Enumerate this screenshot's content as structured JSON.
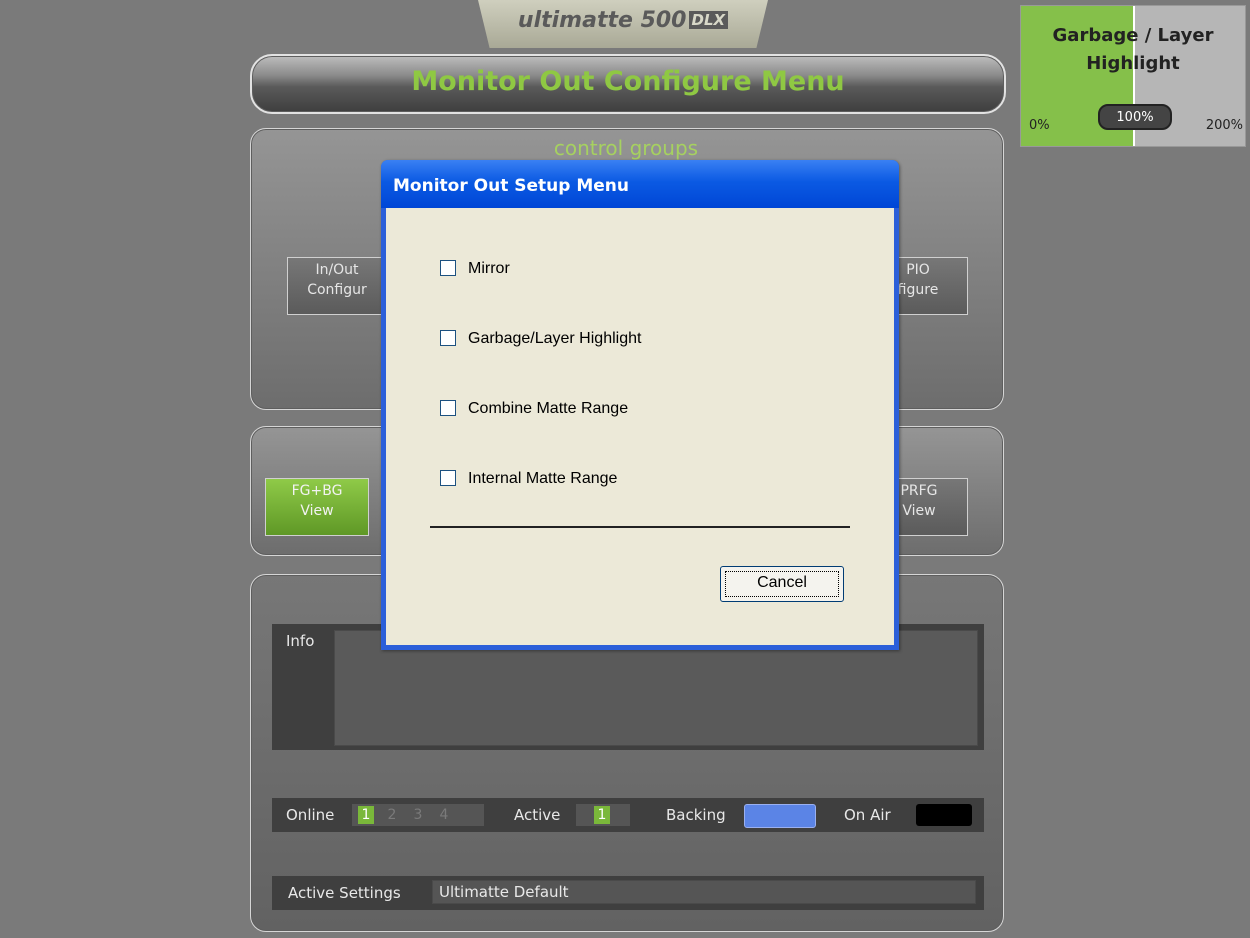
{
  "logo": {
    "text": "ultimatte 500",
    "badge": "DLX"
  },
  "header": {
    "title": "Monitor Out Configure Menu"
  },
  "control_groups": {
    "label": "control groups",
    "left_button": [
      "In/Out",
      "Configur"
    ],
    "right_button": [
      "PIO",
      "figure"
    ]
  },
  "view_buttons": {
    "fg_bg": [
      "FG+BG",
      "View"
    ],
    "prfg": [
      "PRFG",
      "View"
    ]
  },
  "info": {
    "label": "Info",
    "text": ""
  },
  "status": {
    "online_label": "Online",
    "online_numbers": [
      "1",
      "2",
      "3",
      "4"
    ],
    "online_active_index": 0,
    "active_label": "Active",
    "active_value": "1",
    "backing_label": "Backing",
    "backing_color": "#5b84e6",
    "onair_label": "On Air",
    "onair_color": "#000000"
  },
  "settings": {
    "label": "Active Settings",
    "value": "Ultimatte Default"
  },
  "side_panel": {
    "title": "Garbage / Layer Highlight",
    "min": "0%",
    "max": "200%",
    "value": "100%",
    "fraction": 0.5
  },
  "dialog": {
    "title": "Monitor Out Setup Menu",
    "options": [
      {
        "label": "Mirror",
        "checked": false
      },
      {
        "label": "Garbage/Layer Highlight",
        "checked": false
      },
      {
        "label": "Combine Matte Range",
        "checked": false
      },
      {
        "label": "Internal Matte Range",
        "checked": false
      }
    ],
    "cancel_label": "Cancel"
  },
  "colors": {
    "accent_green": "#8fc843",
    "dialog_blue": "#0b5ae3"
  }
}
